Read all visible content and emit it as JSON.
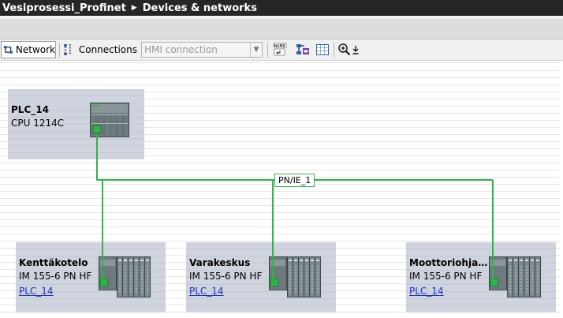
{
  "title": {
    "project": "Vesiprosessi_Profinet",
    "view": "Devices & networks"
  },
  "toolbar": {
    "network_label": "Network",
    "connections_label": "Connections",
    "connection_type_value": "HMI connection",
    "icons": [
      "network-icon",
      "connections-icon",
      "dropdown-arrow-icon",
      "assign-name-icon",
      "show-address-icon",
      "table-view-icon",
      "zoom-in-icon",
      "zoom-dropdown-icon"
    ]
  },
  "network": {
    "subnet_label": "PN/IE_1",
    "line_color": "#2fb34a"
  },
  "devices": {
    "plc": {
      "name": "PLC_14",
      "type": "CPU 1214C"
    },
    "io1": {
      "name": "Kenttäkotelo",
      "type": "IM 155-6 PN HF",
      "link": "PLC_14"
    },
    "io2": {
      "name": "Varakeskus",
      "type": "IM 155-6 PN HF",
      "link": "PLC_14"
    },
    "io3": {
      "name": "Moottoriohjau…",
      "type": "IM 155-6 PN HF",
      "link": "PLC_14"
    }
  }
}
